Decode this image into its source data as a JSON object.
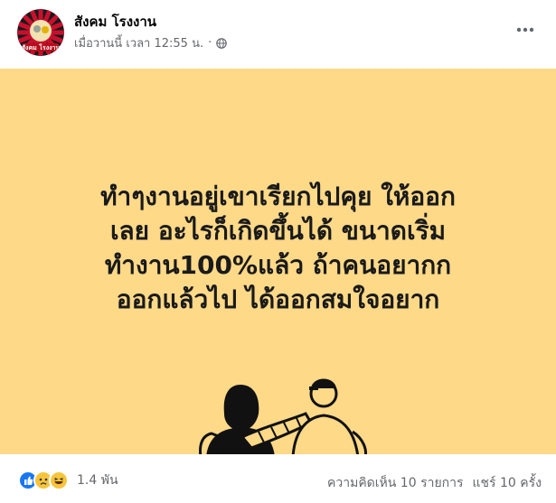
{
  "post": {
    "page_name": "สังคม โรงงาน",
    "avatar_text": "สังคม โรงงาน",
    "timestamp": "เมื่อวานนี้ เวลา 12:55 น.",
    "separator": "·",
    "privacy_icon": "globe-icon",
    "more_icon": "more-horizontal-icon"
  },
  "image": {
    "background": "#fdd988",
    "lines": [
      "ทำๆงานอยู่เขาเรียกไปคุย ให้ออก",
      "เลย อะไรก็เกิดขึ้นได้ ขนาดเริ่ม",
      "ทำงาน100%แล้ว ถ้าคนอยากก",
      "ออกแล้วไป ได้ออกสมใจอยาก"
    ]
  },
  "footer": {
    "reaction_icons": [
      "like-icon",
      "sad-icon",
      "haha-icon"
    ],
    "reaction_count": "1.4 พัน",
    "comments": "ความคิดเห็น 10 รายการ",
    "shares": "แชร์ 10 ครั้ง"
  },
  "colors": {
    "like": "#1877f2",
    "emoji": "#f7c53b",
    "secondary_text": "#65676b"
  }
}
